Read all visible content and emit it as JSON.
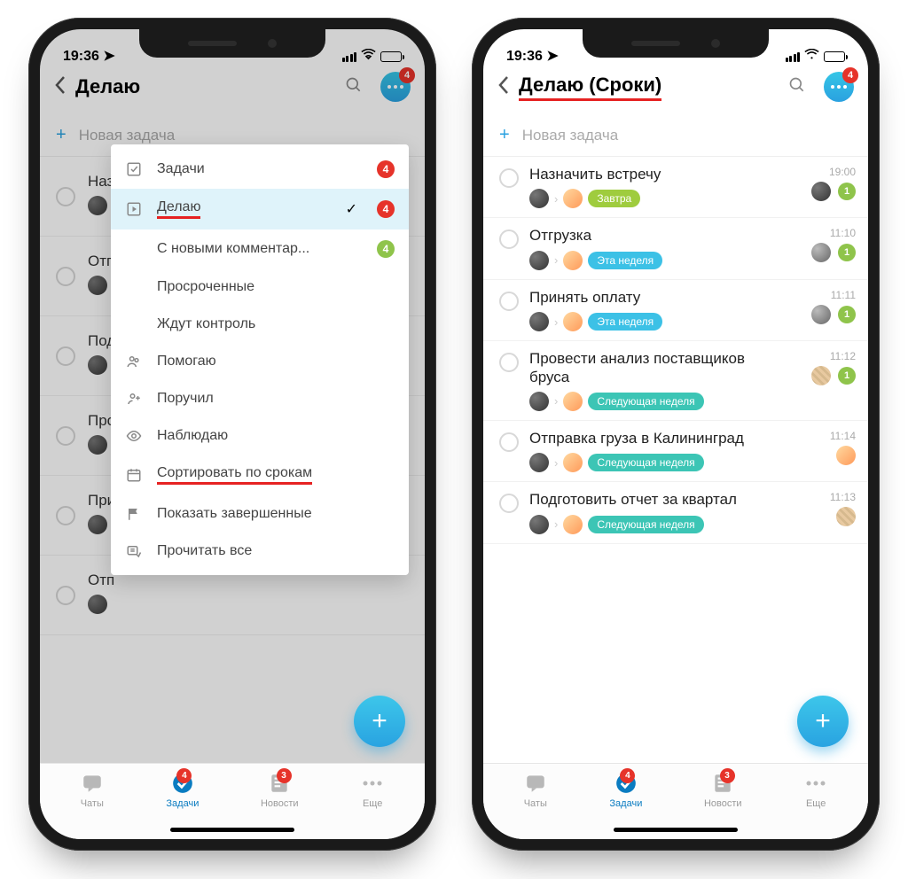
{
  "status": {
    "time": "19:36"
  },
  "left": {
    "title": "Делаю",
    "new_task": "Новая задача",
    "menu_badge": "4",
    "bg_tasks": [
      "Наз",
      "Отг",
      "Под",
      "Про",
      "При",
      "Отп"
    ],
    "dropdown": [
      {
        "kind": "main",
        "icon": "check-square",
        "label": "Задачи",
        "badge": "4",
        "badge_color": "red"
      },
      {
        "kind": "main",
        "icon": "play-square",
        "label": "Делаю",
        "badge": "4",
        "badge_color": "red",
        "active": true,
        "checked": true,
        "underline": true
      },
      {
        "kind": "sub",
        "label": "С новыми комментар...",
        "badge": "4",
        "badge_color": "green"
      },
      {
        "kind": "sub",
        "label": "Просроченные"
      },
      {
        "kind": "sub",
        "label": "Ждут контроль"
      },
      {
        "kind": "main",
        "icon": "people",
        "label": "Помогаю"
      },
      {
        "kind": "main",
        "icon": "assign",
        "label": "Поручил"
      },
      {
        "kind": "main",
        "icon": "eye",
        "label": "Наблюдаю"
      },
      {
        "kind": "main",
        "icon": "calendar",
        "label": "Сортировать по срокам",
        "underline": true
      },
      {
        "kind": "main",
        "icon": "flag",
        "label": "Показать завершенные"
      },
      {
        "kind": "main",
        "icon": "read-all",
        "label": "Прочитать все"
      }
    ]
  },
  "right": {
    "title": "Делаю (Сроки)",
    "new_task": "Новая задача",
    "menu_badge": "4",
    "tasks": [
      {
        "name": "Назначить встречу",
        "time": "19:00",
        "pill": "Завтра",
        "pill_color": "lime",
        "side_av": "av-a",
        "count": "1"
      },
      {
        "name": "Отгрузка",
        "time": "11:10",
        "pill": "Эта неделя",
        "pill_color": "blue",
        "side_av": "av-c",
        "count": "1"
      },
      {
        "name": "Принять оплату",
        "time": "11:11",
        "pill": "Эта неделя",
        "pill_color": "blue",
        "side_av": "av-c",
        "count": "1"
      },
      {
        "name": "Провести анализ поставщиков бруса",
        "time": "11:12",
        "pill": "Следующая неделя",
        "pill_color": "teal",
        "side_av": "av-d",
        "count": "1"
      },
      {
        "name": "Отправка груза в Калининград",
        "time": "11:14",
        "pill": "Следующая неделя",
        "pill_color": "teal",
        "side_av": "av-b",
        "count": ""
      },
      {
        "name": "Подготовить отчет за квартал",
        "time": "11:13",
        "pill": "Следующая неделя",
        "pill_color": "teal",
        "side_av": "av-d",
        "count": ""
      }
    ]
  },
  "tabs": {
    "chats": {
      "label": "Чаты"
    },
    "tasks": {
      "label": "Задачи",
      "badge": "4"
    },
    "news": {
      "label": "Новости",
      "badge": "3"
    },
    "more": {
      "label": "Еще"
    }
  },
  "colors": {
    "accent": "#2aa1e0",
    "badge_red": "#e6332a"
  }
}
